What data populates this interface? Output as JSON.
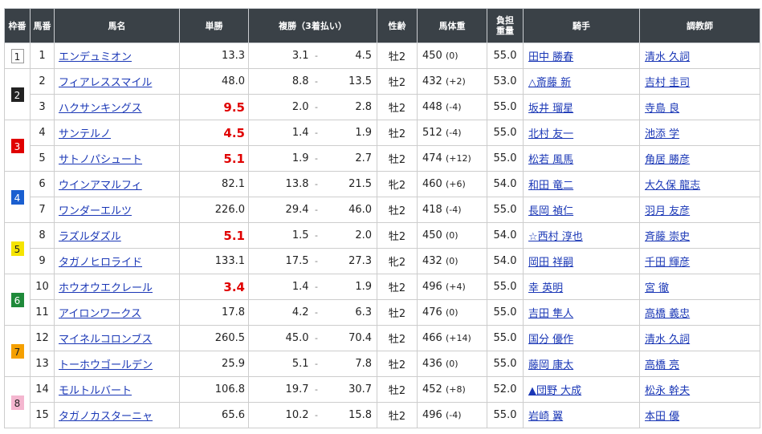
{
  "header": {
    "waku": "枠番",
    "umaban": "馬番",
    "name": "馬名",
    "win": "単勝",
    "place": "複勝（3着払い）",
    "sex_age": "性齢",
    "weight": "馬体重",
    "load_line1": "負担",
    "load_line2": "重量",
    "jockey": "騎手",
    "trainer": "調教師"
  },
  "separator": "-",
  "waku_colors": {
    "1": {
      "bg": "#ffffff",
      "fg": "#222222",
      "border": "#999999"
    },
    "2": {
      "bg": "#222222",
      "fg": "#ffffff",
      "border": "#222222"
    },
    "3": {
      "bg": "#e00000",
      "fg": "#ffffff",
      "border": "#e00000"
    },
    "4": {
      "bg": "#1a5fd0",
      "fg": "#ffffff",
      "border": "#1a5fd0"
    },
    "5": {
      "bg": "#f5e400",
      "fg": "#222222",
      "border": "#f5e400"
    },
    "6": {
      "bg": "#1f8a3a",
      "fg": "#ffffff",
      "border": "#1f8a3a"
    },
    "7": {
      "bg": "#f5a000",
      "fg": "#222222",
      "border": "#f5a000"
    },
    "8": {
      "bg": "#f4b6cf",
      "fg": "#222222",
      "border": "#f4b6cf"
    }
  },
  "rows": [
    {
      "waku": "1",
      "num": "1",
      "name": "エンデュミオン",
      "win": "13.3",
      "win_popular": false,
      "place_min": "3.1",
      "place_max": "4.5",
      "sex_age": "牡2",
      "weight": "450",
      "diff": "(0)",
      "load": "55.0",
      "jockey": "田中 勝春",
      "trainer": "清水 久詞"
    },
    {
      "waku": "2",
      "num": "2",
      "name": "フィアレススマイル",
      "win": "48.0",
      "win_popular": false,
      "place_min": "8.8",
      "place_max": "13.5",
      "sex_age": "牡2",
      "weight": "432",
      "diff": "(+2)",
      "load": "53.0",
      "jockey": "△斎藤 新",
      "trainer": "吉村 圭司"
    },
    {
      "waku": "2",
      "num": "3",
      "name": "ハクサンキングス",
      "win": "9.5",
      "win_popular": true,
      "place_min": "2.0",
      "place_max": "2.8",
      "sex_age": "牡2",
      "weight": "448",
      "diff": "(-4)",
      "load": "55.0",
      "jockey": "坂井 瑠星",
      "trainer": "寺島 良"
    },
    {
      "waku": "3",
      "num": "4",
      "name": "サンテルノ",
      "win": "4.5",
      "win_popular": true,
      "place_min": "1.4",
      "place_max": "1.9",
      "sex_age": "牡2",
      "weight": "512",
      "diff": "(-4)",
      "load": "55.0",
      "jockey": "北村 友一",
      "trainer": "池添 学"
    },
    {
      "waku": "3",
      "num": "5",
      "name": "サトノパシュート",
      "win": "5.1",
      "win_popular": true,
      "place_min": "1.9",
      "place_max": "2.7",
      "sex_age": "牡2",
      "weight": "474",
      "diff": "(+12)",
      "load": "55.0",
      "jockey": "松若 風馬",
      "trainer": "角居 勝彦"
    },
    {
      "waku": "4",
      "num": "6",
      "name": "ウインアマルフィ",
      "win": "82.1",
      "win_popular": false,
      "place_min": "13.8",
      "place_max": "21.5",
      "sex_age": "牝2",
      "weight": "460",
      "diff": "(+6)",
      "load": "54.0",
      "jockey": "和田 竜二",
      "trainer": "大久保 龍志"
    },
    {
      "waku": "4",
      "num": "7",
      "name": "ワンダーエルツ",
      "win": "226.0",
      "win_popular": false,
      "place_min": "29.4",
      "place_max": "46.0",
      "sex_age": "牡2",
      "weight": "418",
      "diff": "(-4)",
      "load": "55.0",
      "jockey": "長岡 禎仁",
      "trainer": "羽月 友彦"
    },
    {
      "waku": "5",
      "num": "8",
      "name": "ラズルダズル",
      "win": "5.1",
      "win_popular": true,
      "place_min": "1.5",
      "place_max": "2.0",
      "sex_age": "牡2",
      "weight": "450",
      "diff": "(0)",
      "load": "54.0",
      "jockey": "☆西村 淳也",
      "trainer": "斉藤 崇史"
    },
    {
      "waku": "5",
      "num": "9",
      "name": "タガノヒロライド",
      "win": "133.1",
      "win_popular": false,
      "place_min": "17.5",
      "place_max": "27.3",
      "sex_age": "牝2",
      "weight": "432",
      "diff": "(0)",
      "load": "54.0",
      "jockey": "岡田 祥嗣",
      "trainer": "千田 輝彦"
    },
    {
      "waku": "6",
      "num": "10",
      "name": "ホウオウエクレール",
      "win": "3.4",
      "win_popular": true,
      "place_min": "1.4",
      "place_max": "1.9",
      "sex_age": "牡2",
      "weight": "496",
      "diff": "(+4)",
      "load": "55.0",
      "jockey": "幸 英明",
      "trainer": "宮 徹"
    },
    {
      "waku": "6",
      "num": "11",
      "name": "アイロンワークス",
      "win": "17.8",
      "win_popular": false,
      "place_min": "4.2",
      "place_max": "6.3",
      "sex_age": "牡2",
      "weight": "476",
      "diff": "(0)",
      "load": "55.0",
      "jockey": "吉田 隼人",
      "trainer": "高橋 義忠"
    },
    {
      "waku": "7",
      "num": "12",
      "name": "マイネルコロンブス",
      "win": "260.5",
      "win_popular": false,
      "place_min": "45.0",
      "place_max": "70.4",
      "sex_age": "牡2",
      "weight": "466",
      "diff": "(+14)",
      "load": "55.0",
      "jockey": "国分 優作",
      "trainer": "清水 久詞"
    },
    {
      "waku": "7",
      "num": "13",
      "name": "トーホウゴールデン",
      "win": "25.9",
      "win_popular": false,
      "place_min": "5.1",
      "place_max": "7.8",
      "sex_age": "牡2",
      "weight": "436",
      "diff": "(0)",
      "load": "55.0",
      "jockey": "藤岡 康太",
      "trainer": "高橋 亮"
    },
    {
      "waku": "8",
      "num": "14",
      "name": "モルトルバート",
      "win": "106.8",
      "win_popular": false,
      "place_min": "19.7",
      "place_max": "30.7",
      "sex_age": "牡2",
      "weight": "452",
      "diff": "(+8)",
      "load": "52.0",
      "jockey": "▲団野 大成",
      "trainer": "松永 幹夫"
    },
    {
      "waku": "8",
      "num": "15",
      "name": "タガノカスターニャ",
      "win": "65.6",
      "win_popular": false,
      "place_min": "10.2",
      "place_max": "15.8",
      "sex_age": "牡2",
      "weight": "496",
      "diff": "(-4)",
      "load": "55.0",
      "jockey": "岩崎 翼",
      "trainer": "本田 優"
    }
  ]
}
